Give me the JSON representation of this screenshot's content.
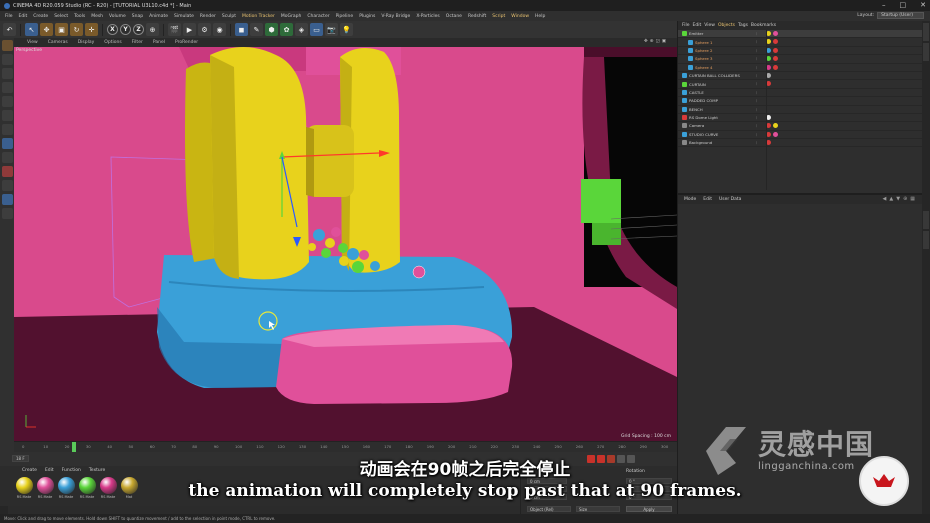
{
  "window": {
    "title": "CINEMA 4D R20.059 Studio (RC - R20) - [TUTORIAL U3L10.c4d *] - Main",
    "controls": [
      "–",
      "□",
      "✕"
    ]
  },
  "menubar": {
    "items": [
      "File",
      "Edit",
      "Create",
      "Select",
      "Tools",
      "Mesh",
      "Volume",
      "Snap",
      "Animate",
      "Simulate",
      "Render",
      "Sculpt",
      "Motion Tracker",
      "MoGraph",
      "Character",
      "Pipeline",
      "Plugins",
      "V-Ray Bridge",
      "X-Particles",
      "Octane",
      "Redshift",
      "Script",
      "Window",
      "Help"
    ],
    "highlighted": [
      "Motion Tracker",
      "Script",
      "Window"
    ],
    "layout_label": "Layout:",
    "layout_value": "Startup (User)"
  },
  "toolbar": {
    "xyz": [
      "X",
      "Y",
      "Z"
    ]
  },
  "viewport": {
    "menu": [
      "View",
      "Cameras",
      "Display",
      "Options",
      "Filter",
      "Panel",
      "ProRender"
    ],
    "label": "Perspective",
    "grid_spacing": "Grid Spacing : 100 cm",
    "colors": {
      "background": "#4a0e2a",
      "backdrop": "#d94a8c",
      "yellow": "#e8d21c",
      "blue": "#3aa0d8",
      "pink": "#e0509a",
      "green": "#5ad63a"
    }
  },
  "timeline": {
    "ticks": [
      "0",
      "10",
      "20",
      "30",
      "40",
      "50",
      "60",
      "70",
      "80",
      "90",
      "100",
      "110",
      "120",
      "130",
      "140",
      "150",
      "160",
      "170",
      "180",
      "190",
      "200",
      "210",
      "220",
      "230",
      "240",
      "250",
      "260",
      "270",
      "280",
      "290",
      "300"
    ],
    "current_frame": "18 F"
  },
  "materials": {
    "menu": [
      "Create",
      "Edit",
      "Function",
      "Texture"
    ],
    "items": [
      {
        "name": "RS Mate",
        "color": "#e8d21c"
      },
      {
        "name": "RS Mate",
        "color": "#e0509a"
      },
      {
        "name": "RS Mate",
        "color": "#3aa0d8"
      },
      {
        "name": "RS Mate",
        "color": "#5ad63a"
      },
      {
        "name": "RS Mate",
        "color": "#d83a8a"
      },
      {
        "name": "Mat",
        "color": "#c8a830"
      }
    ]
  },
  "coordinates": {
    "header": "Rotation",
    "fields": [
      "0 cm",
      "0 cm",
      "0 cm",
      "0 °",
      "0 °",
      "0 °"
    ],
    "mode_left": "Object (Rel)",
    "mode_right": "Size",
    "apply": "Apply"
  },
  "objects": {
    "menu": [
      "File",
      "Edit",
      "View",
      "Objects",
      "Tags",
      "Bookmarks"
    ],
    "active_menu": "Objects",
    "rows": [
      {
        "name": "Emitter",
        "icon": "#5ad63a",
        "tags": [
          "#e8d21c",
          "#e0509a"
        ],
        "sel": true,
        "child": false
      },
      {
        "name": "Sphere 1",
        "icon": "#3aa0d8",
        "tags": [
          "#e8d21c",
          "#d83a3a"
        ],
        "sel": false,
        "child": true
      },
      {
        "name": "Sphere 2",
        "icon": "#3aa0d8",
        "tags": [
          "#3aa0d8",
          "#d83a3a"
        ],
        "sel": false,
        "child": true
      },
      {
        "name": "Sphere 3",
        "icon": "#3aa0d8",
        "tags": [
          "#5ad63a",
          "#d83a3a"
        ],
        "sel": false,
        "child": true
      },
      {
        "name": "Sphere 4",
        "icon": "#3aa0d8",
        "tags": [
          "#d83a8a",
          "#d83a3a"
        ],
        "sel": false,
        "child": true
      },
      {
        "name": "CURTAIN BALL COLLIDERS",
        "icon": "#3aa0d8",
        "tags": [
          "#aaaaaa"
        ],
        "sel": false,
        "child": false
      },
      {
        "name": "CURTAIN",
        "icon": "#5ad63a",
        "tags": [
          "#d83a3a"
        ],
        "sel": false,
        "child": false
      },
      {
        "name": "CASTLE",
        "icon": "#3aa0d8",
        "tags": [],
        "sel": false,
        "child": false
      },
      {
        "name": "PADDED COMP",
        "icon": "#3aa0d8",
        "tags": [],
        "sel": false,
        "child": false
      },
      {
        "name": "BENCH",
        "icon": "#3aa0d8",
        "tags": [],
        "sel": false,
        "child": false
      },
      {
        "name": "RS Dome Light",
        "icon": "#d83a3a",
        "tags": [
          "#eeeeee"
        ],
        "sel": false,
        "child": false
      },
      {
        "name": "Camera",
        "icon": "#888888",
        "tags": [
          "#d83a3a",
          "#e8d21c"
        ],
        "sel": false,
        "child": false
      },
      {
        "name": "STUDIO CURVE",
        "icon": "#3aa0d8",
        "tags": [
          "#d83a3a",
          "#e0509a"
        ],
        "sel": false,
        "child": false
      },
      {
        "name": "Background",
        "icon": "#888888",
        "tags": [
          "#d83a3a"
        ],
        "sel": false,
        "child": false
      }
    ]
  },
  "attributes": {
    "menu": [
      "Mode",
      "Edit",
      "User Data"
    ]
  },
  "status": {
    "text": "Move: Click and drag to move elements. Hold down SHIFT to quantize movement / add to the selection in point mode, CTRL to remove."
  },
  "subtitles": {
    "chinese": "动画会在90帧之后完全停止",
    "english": "the animation will completely stop past that at 90 frames."
  },
  "watermark": {
    "brand": "灵感中国",
    "url": "lingganchina.com"
  }
}
